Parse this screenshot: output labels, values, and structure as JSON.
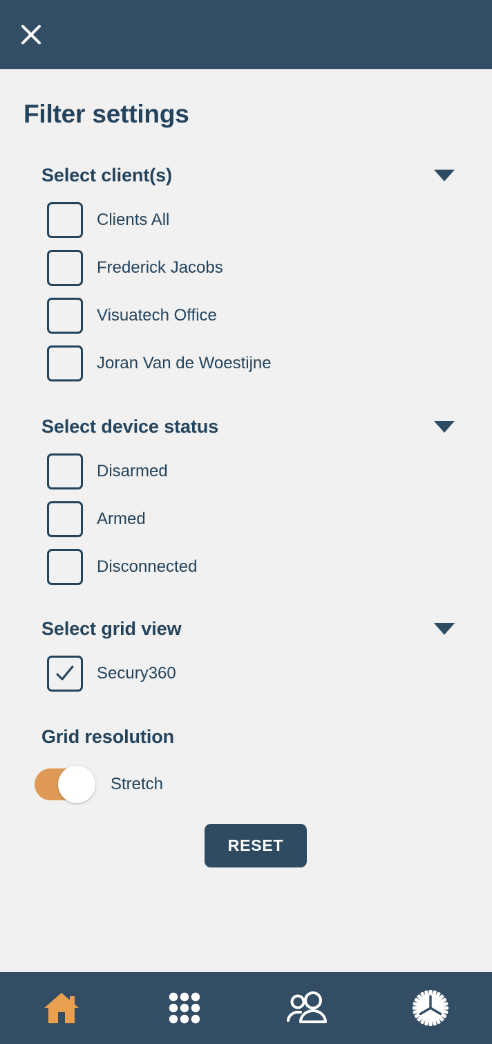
{
  "header": {
    "close_icon": "close-icon"
  },
  "page": {
    "title": "Filter settings"
  },
  "colors": {
    "header_bg": "#324d64",
    "body_bg": "#f1f1f1",
    "accent_text": "#24435c",
    "toggle_on": "#e09a57",
    "nav_active": "#e8a050",
    "reset_bg": "#2e4b61"
  },
  "sections": [
    {
      "title": "Select client(s)",
      "expanded": true,
      "caret_icon": "chevron-down-icon",
      "options": [
        {
          "label": "Clients All",
          "checked": false
        },
        {
          "label": "Frederick Jacobs",
          "checked": false
        },
        {
          "label": "Visuatech Office",
          "checked": false
        },
        {
          "label": "Joran Van de Woestijne",
          "checked": false
        }
      ]
    },
    {
      "title": "Select device status",
      "expanded": true,
      "caret_icon": "chevron-down-icon",
      "options": [
        {
          "label": "Disarmed",
          "checked": false
        },
        {
          "label": "Armed",
          "checked": false
        },
        {
          "label": "Disconnected",
          "checked": false
        }
      ]
    },
    {
      "title": "Select grid view",
      "expanded": true,
      "caret_icon": "chevron-down-icon",
      "options": [
        {
          "label": "Secury360",
          "checked": true
        }
      ]
    }
  ],
  "grid_resolution": {
    "title": "Grid resolution",
    "toggle_label": "Stretch",
    "toggle_on": true
  },
  "reset": {
    "label": "RESET"
  },
  "bottom_nav": {
    "items": [
      {
        "name": "home",
        "icon": "home-icon",
        "active": true
      },
      {
        "name": "grid",
        "icon": "grid-dots-icon",
        "active": false
      },
      {
        "name": "clients",
        "icon": "people-icon",
        "active": false
      },
      {
        "name": "settings",
        "icon": "gear-icon",
        "active": false
      }
    ]
  }
}
